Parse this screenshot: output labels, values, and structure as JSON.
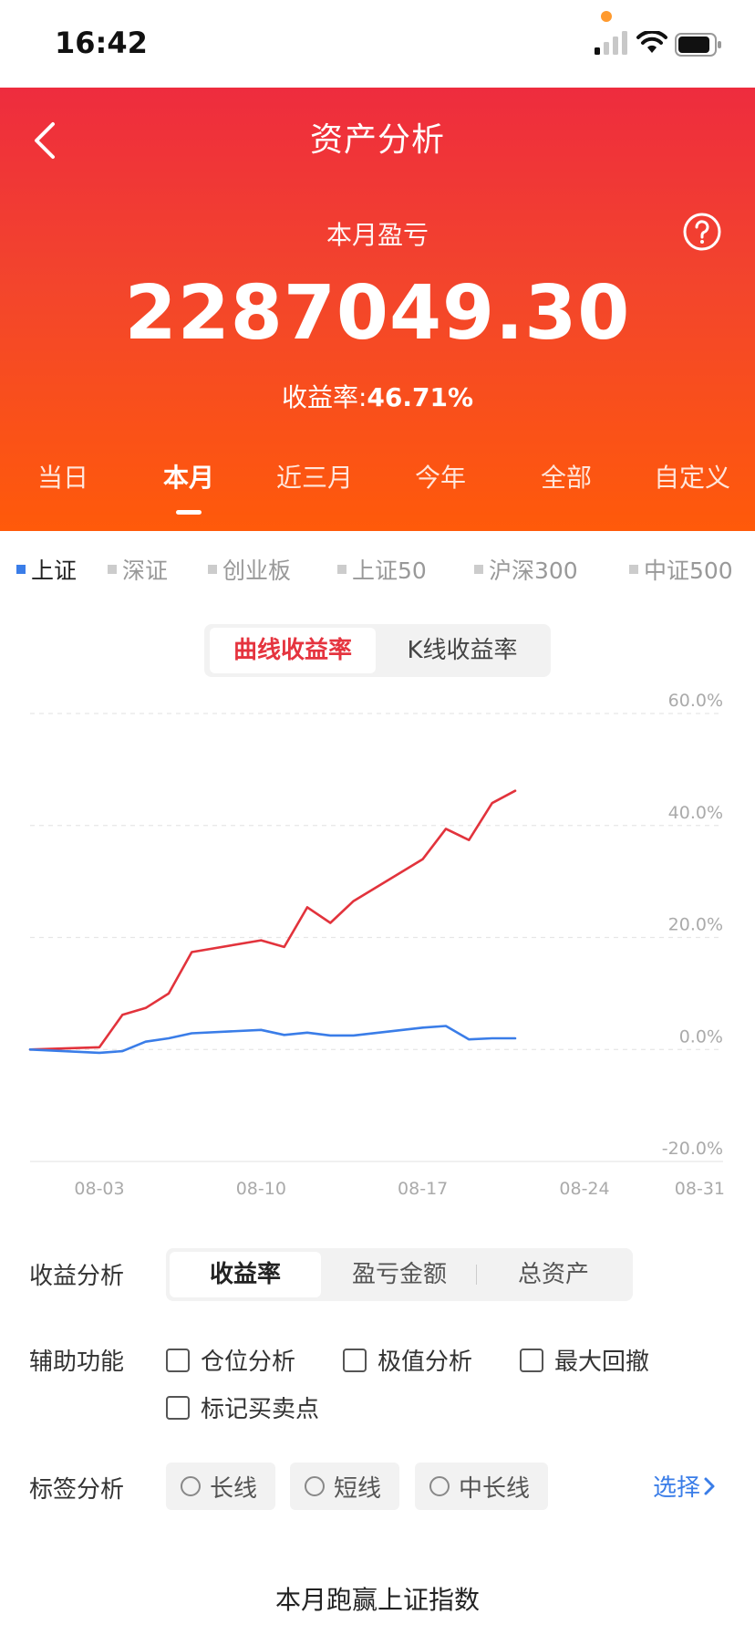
{
  "status_bar": {
    "time": "16:42"
  },
  "header": {
    "title": "资产分析",
    "pl_label": "本月盈亏",
    "pl_amount": "2287049.30",
    "rate_label": "收益率:",
    "rate_value": "46.71%"
  },
  "period_tabs": [
    {
      "label": "当日",
      "active": false
    },
    {
      "label": "本月",
      "active": true
    },
    {
      "label": "近三月",
      "active": false
    },
    {
      "label": "今年",
      "active": false
    },
    {
      "label": "全部",
      "active": false
    },
    {
      "label": "自定义",
      "active": false
    }
  ],
  "index_tabs": [
    {
      "label": "上证",
      "active": true
    },
    {
      "label": "深证",
      "active": false
    },
    {
      "label": "创业板",
      "active": false
    },
    {
      "label": "上证50",
      "active": false
    },
    {
      "label": "沪深300",
      "active": false
    },
    {
      "label": "中证500",
      "active": false
    }
  ],
  "curve_toggle": {
    "active": "曲线收益率",
    "inactive": "K线收益率"
  },
  "chart_data": {
    "type": "line",
    "ylim": [
      -20,
      60
    ],
    "y_ticks": [
      "60.0%",
      "40.0%",
      "20.0%",
      "0.0%",
      "-20.0%"
    ],
    "y_tick_values": [
      60,
      40,
      20,
      0,
      -20
    ],
    "xlim": [
      0,
      30
    ],
    "x_ticks": [
      "08-03",
      "08-10",
      "08-17",
      "08-24",
      "08-31"
    ],
    "x_tick_values": [
      3,
      10,
      17,
      24,
      30
    ],
    "grid": true,
    "series": [
      {
        "color": "#e2333c",
        "x": [
          0,
          3,
          4,
          5,
          6,
          7,
          10,
          11,
          12,
          13,
          14,
          17,
          18,
          19,
          20,
          21
        ],
        "values": [
          0,
          0.4,
          6.2,
          7.4,
          10,
          17.4,
          19.5,
          18.3,
          25.4,
          22.6,
          26.5,
          34,
          39.4,
          37.4,
          44,
          46.2
        ]
      },
      {
        "color": "#3a7de8",
        "x": [
          0,
          3,
          4,
          5,
          6,
          7,
          10,
          11,
          12,
          13,
          14,
          17,
          18,
          19,
          20,
          21
        ],
        "values": [
          0,
          -0.6,
          -0.3,
          1.4,
          2,
          2.9,
          3.5,
          2.6,
          3,
          2.5,
          2.5,
          3.9,
          4.2,
          1.8,
          2,
          2
        ]
      }
    ]
  },
  "analysis": {
    "label": "收益分析",
    "options": [
      {
        "label": "收益率",
        "active": true
      },
      {
        "label": "盈亏金额",
        "active": false
      },
      {
        "label": "总资产",
        "active": false
      }
    ]
  },
  "aux": {
    "label": "辅助功能",
    "options": [
      "仓位分析",
      "极值分析",
      "最大回撤",
      "标记买卖点"
    ]
  },
  "tags": {
    "label": "标签分析",
    "options": [
      "长线",
      "短线",
      "中长线"
    ],
    "select_label": "选择"
  },
  "footer": {
    "text": "本月跑赢上证指数"
  }
}
